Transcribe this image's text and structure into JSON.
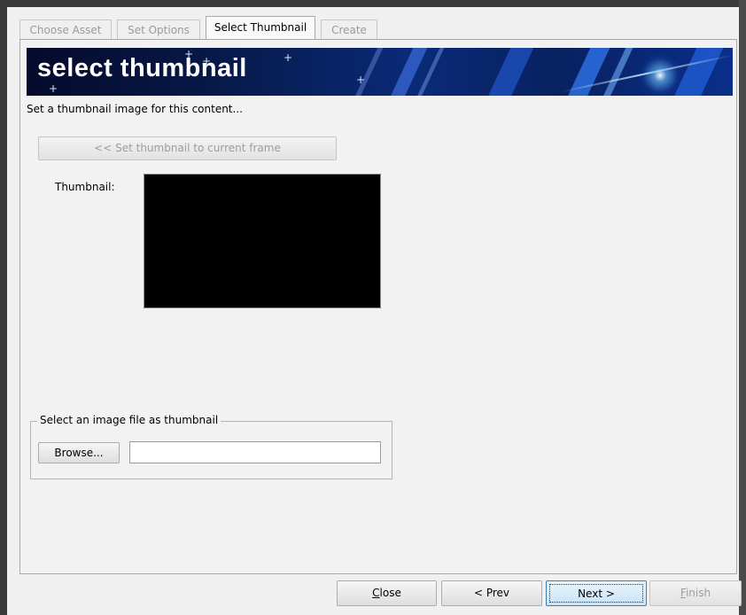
{
  "tabs": [
    {
      "label": "Choose Asset",
      "active": false
    },
    {
      "label": "Set Options",
      "active": false
    },
    {
      "label": "Select Thumbnail",
      "active": true
    },
    {
      "label": "Create",
      "active": false
    }
  ],
  "banner": {
    "title": "select thumbnail"
  },
  "subtitle": "Set a thumbnail image for this content...",
  "set_frame_button": "<< Set thumbnail to current frame",
  "thumbnail": {
    "label": "Thumbnail:"
  },
  "file_group": {
    "legend": "Select an image file as thumbnail",
    "browse_label": "Browse...",
    "file_value": ""
  },
  "footer": {
    "close_accel": "C",
    "close_rest": "lose",
    "prev_label": "< Prev",
    "next_label": "Next >",
    "finish_accel": "F",
    "finish_rest": "inish"
  },
  "colors": {
    "banner_dark": "#050a2c",
    "banner_blue": "#0a2a78",
    "next_border": "#3c7fb1"
  }
}
